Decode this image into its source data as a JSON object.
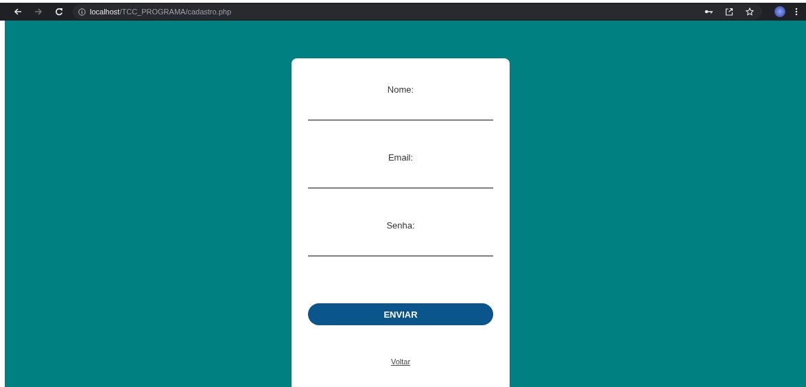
{
  "browser": {
    "url": "**localhost**/TCC_PROGRAMA/cadastro.php"
  },
  "form": {
    "fields": [
      {
        "label": "Nome:"
      },
      {
        "label": "Email:"
      },
      {
        "label": "Senha:"
      }
    ],
    "submit": "ENVIAR",
    "back_link": "Voltar"
  }
}
